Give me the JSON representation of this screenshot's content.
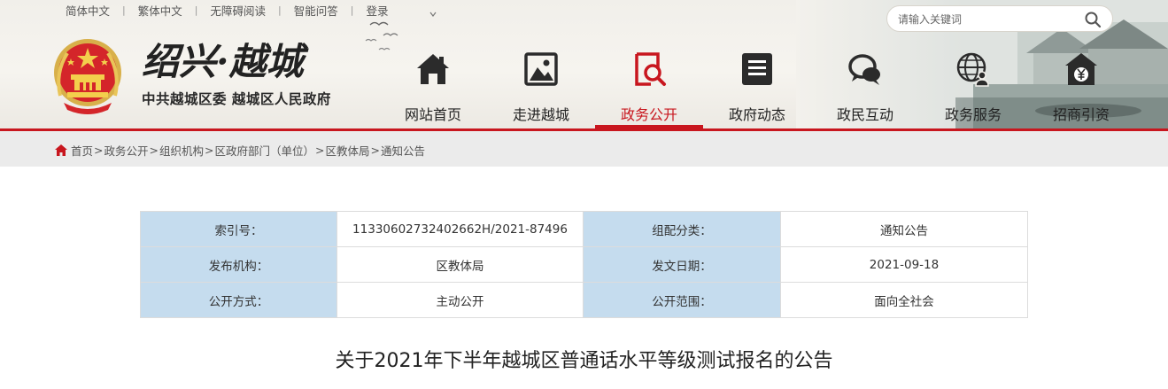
{
  "topbar": {
    "links": [
      "简体中文",
      "繁体中文",
      "无障碍阅读",
      "智能问答",
      "登录"
    ]
  },
  "search": {
    "placeholder": "请输入关键词",
    "icon": "search-icon"
  },
  "logo": {
    "title": "绍兴·越城",
    "subtitle": "中共越城区委 越城区人民政府"
  },
  "nav": {
    "items": [
      {
        "label": "网站首页",
        "icon": "home-icon",
        "active": false
      },
      {
        "label": "走进越城",
        "icon": "picture-icon",
        "active": false
      },
      {
        "label": "政务公开",
        "icon": "document-search-icon",
        "active": true
      },
      {
        "label": "政府动态",
        "icon": "news-list-icon",
        "active": false
      },
      {
        "label": "政民互动",
        "icon": "chat-icon",
        "active": false
      },
      {
        "label": "政务服务",
        "icon": "globe-user-icon",
        "active": false
      },
      {
        "label": "招商引资",
        "icon": "yuan-house-icon",
        "active": false
      }
    ]
  },
  "breadcrumb": [
    "首页",
    "政务公开",
    "组织机构",
    "区政府部门（单位）",
    "区教体局",
    "通知公告"
  ],
  "meta": {
    "rows": [
      {
        "k1": "索引号：",
        "v1": "11330602732402662H/2021-87496",
        "k2": "组配分类：",
        "v2": "通知公告"
      },
      {
        "k1": "发布机构：",
        "v1": "区教体局",
        "k2": "发文日期：",
        "v2": "2021-09-18"
      },
      {
        "k1": "公开方式：",
        "v1": "主动公开",
        "k2": "公开范围：",
        "v2": "面向全社会"
      }
    ]
  },
  "article": {
    "title": "关于2021年下半年越城区普通话水平等级测试报名的公告"
  },
  "colors": {
    "accent": "#c8161e",
    "label_cell": "#c5dcee"
  }
}
